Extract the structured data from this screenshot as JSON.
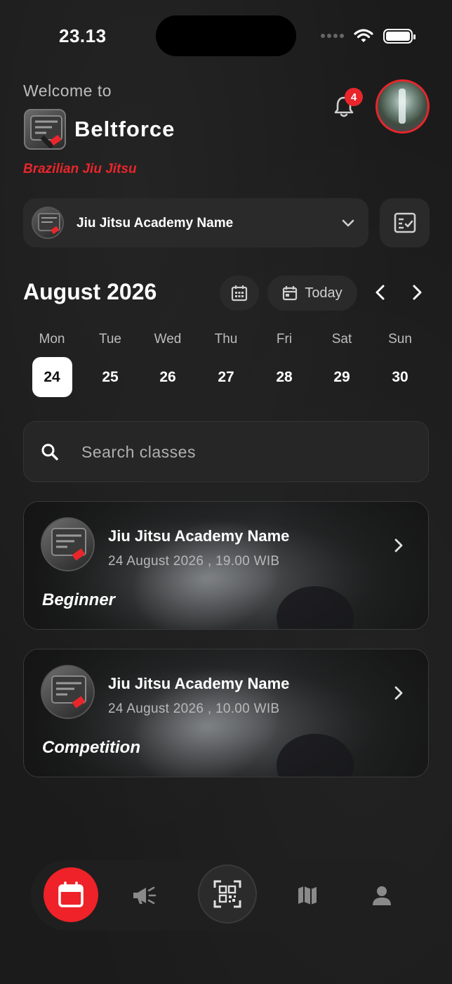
{
  "status_bar": {
    "time": "23.13"
  },
  "header": {
    "welcome": "Welcome to",
    "brand_name": "Beltforce",
    "brand_sub": "Brazilian Jiu Jitsu",
    "notification_count": "4"
  },
  "academy_selector": {
    "selected": "Jiu Jitsu Academy Name"
  },
  "calendar": {
    "month_title": "August 2026",
    "today_label": "Today",
    "days": [
      {
        "name": "Mon",
        "num": "24",
        "selected": true
      },
      {
        "name": "Tue",
        "num": "25"
      },
      {
        "name": "Wed",
        "num": "26"
      },
      {
        "name": "Thu",
        "num": "27"
      },
      {
        "name": "Fri",
        "num": "28"
      },
      {
        "name": "Sat",
        "num": "29"
      },
      {
        "name": "Sun",
        "num": "30"
      }
    ]
  },
  "search": {
    "placeholder": "Search classes"
  },
  "classes": [
    {
      "academy": "Jiu Jitsu Academy Name",
      "datetime": "24 August 2026 , 19.00 WIB",
      "level": "Beginner"
    },
    {
      "academy": "Jiu Jitsu Academy Name",
      "datetime": "24 August 2026 , 10.00 WIB",
      "level": "Competition"
    }
  ],
  "tabbar": {
    "items": [
      "calendar-icon",
      "megaphone-icon",
      "qr-scan-icon",
      "map-icon",
      "profile-icon"
    ],
    "active": "calendar-icon"
  },
  "colors": {
    "accent": "#e8262b",
    "background": "#1b1b1b",
    "surface": "#2a2a2a"
  }
}
